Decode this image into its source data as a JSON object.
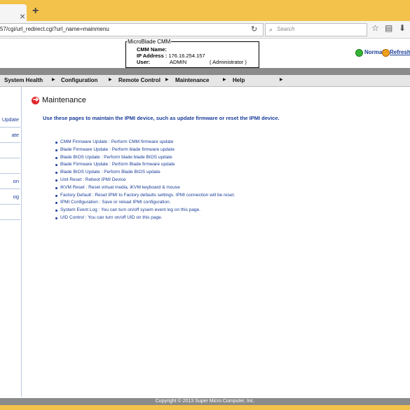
{
  "browser": {
    "tab_close": "×",
    "tab_new": "+",
    "url": "57/cgi/url_redirect.cgi?url_name=mainmenu",
    "search_placeholder": "Search"
  },
  "header": {
    "title": "MicroBlade CMM",
    "cmm_name_label": "CMM Name:",
    "cmm_name_value": "",
    "ip_label": "IP Address :",
    "ip_value": "176.16.254.157",
    "user_label": "User:",
    "user_value": "ADMIN",
    "user_role": "( Administrator )",
    "status_text": "Normal",
    "refresh_text": "Refresh",
    "status_color": "#33b533"
  },
  "menu": {
    "items": [
      {
        "label": "System Health"
      },
      {
        "label": "Configuration"
      },
      {
        "label": "Remote Control"
      },
      {
        "label": "Maintenance"
      },
      {
        "label": "Help"
      }
    ]
  },
  "sidebar": {
    "items": [
      {
        "label": "Update"
      },
      {
        "label": "ate"
      },
      {
        "label": ""
      },
      {
        "label": ""
      },
      {
        "label": "on"
      },
      {
        "label": "og"
      },
      {
        "label": ""
      }
    ]
  },
  "content": {
    "title": "Maintenance",
    "description": "Use these pages to maintain the IPMI device, such as update firmware or reset the IPMI device.",
    "links": [
      "CMM Firmware Update : Perform CMM firmware update",
      "Blade Firmware Update : Perform blade firmware update",
      "Blade BIOS Update : Perform blade blade BIOS update",
      "Blade Firmware Update : Perform Blade firmware update",
      "Blade BIOS Update : Perform Blade BIOS update",
      "Unit Reset : Reboot IPMI Device",
      "IKVM Reset : Reset virtual media, iKVM keyboard & mouse",
      "Factory Default : Reset IPMI to Factory defaults settings. IPMI connection will be reset.",
      "IPMI Configuration : Save or reload IPMI configuration.",
      "System Event Log : You can turn on/off sysem event log on this page.",
      "UID Control : You can turn on/off UID on this page."
    ]
  },
  "footer": {
    "copyright": "Copyright © 2013 Super Micro Computer, Inc."
  }
}
